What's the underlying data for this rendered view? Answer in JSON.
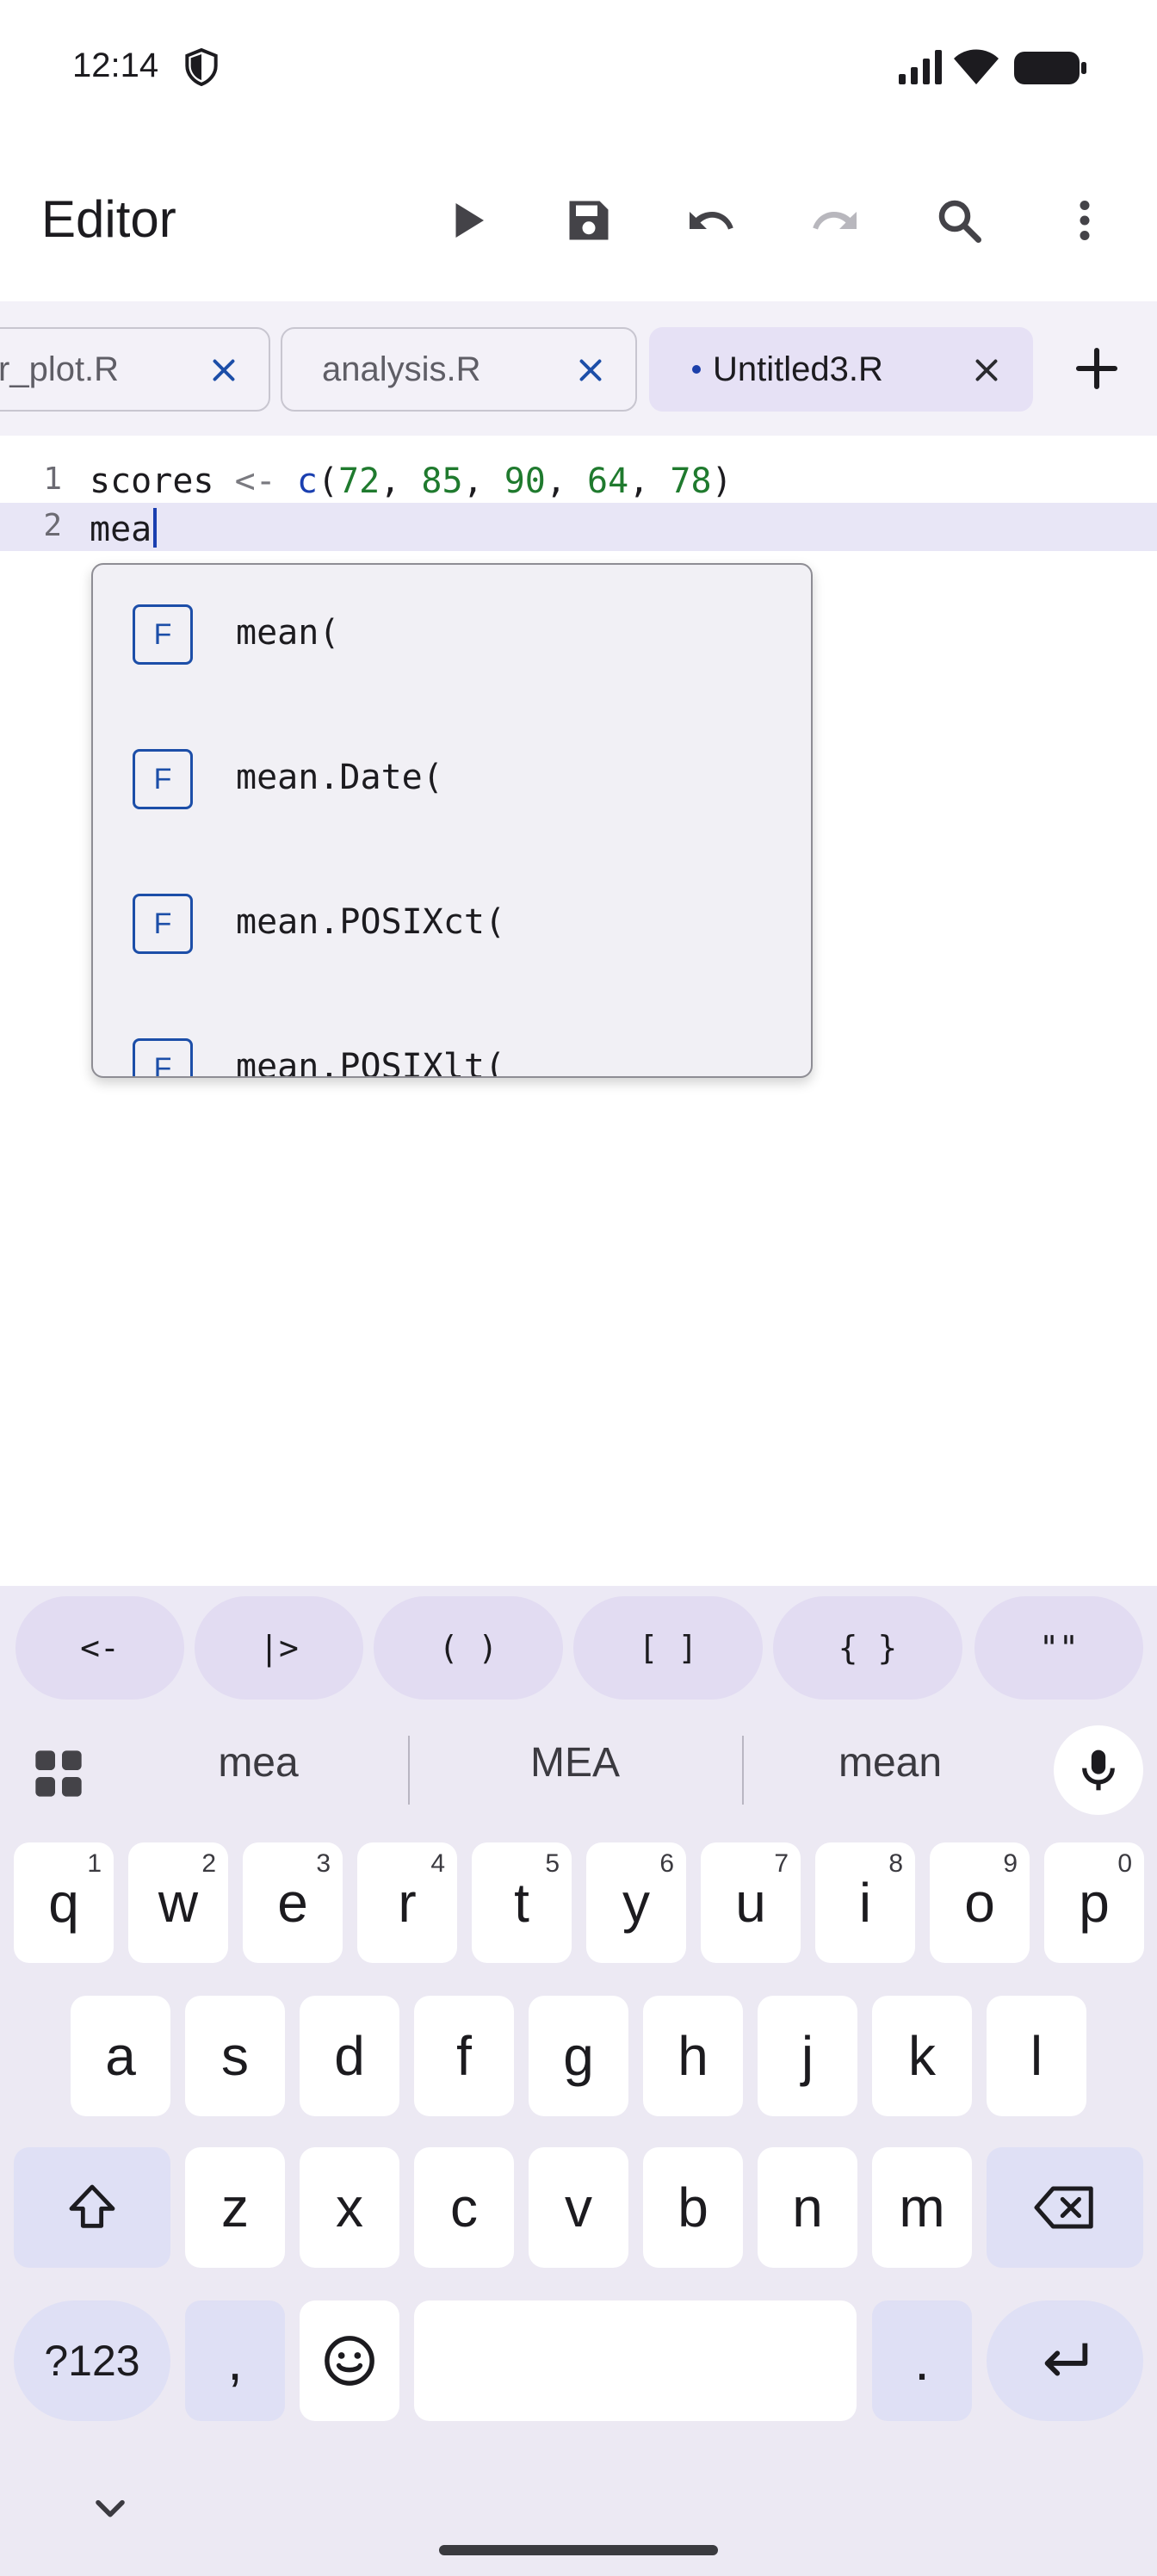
{
  "status_bar": {
    "time": "12:14"
  },
  "toolbar": {
    "title": "Editor",
    "actions": [
      "run",
      "save",
      "undo",
      "redo",
      "search",
      "more"
    ]
  },
  "tabs": [
    {
      "label": "r_plot.R",
      "active": false
    },
    {
      "label": "analysis.R",
      "active": false
    },
    {
      "label": "Untitled3.R",
      "active": true,
      "modified": true
    }
  ],
  "editor": {
    "lines": [
      {
        "number": "1",
        "tokens": {
          "var": "scores",
          "op": " <- ",
          "fn": "c",
          "open": "(",
          "n1": "72",
          "s1": ", ",
          "n2": "85",
          "s2": ", ",
          "n3": "90",
          "s3": ", ",
          "n4": "64",
          "s4": ", ",
          "n5": "78",
          "close": ")"
        }
      },
      {
        "number": "2",
        "text": "mea"
      }
    ]
  },
  "autocomplete": {
    "items": [
      {
        "kind": "F",
        "label": "mean("
      },
      {
        "kind": "F",
        "label": "mean.Date("
      },
      {
        "kind": "F",
        "label": "mean.POSIXct("
      },
      {
        "kind": "F",
        "label": "mean.POSIXlt("
      }
    ]
  },
  "symbol_bar": {
    "items": [
      "<-",
      "|>",
      "( )",
      "[ ]",
      "{ }",
      "\"\""
    ]
  },
  "keyboard": {
    "suggestions": [
      "mea",
      "MEA",
      "mean"
    ],
    "row1": [
      {
        "key": "q",
        "hint": "1"
      },
      {
        "key": "w",
        "hint": "2"
      },
      {
        "key": "e",
        "hint": "3"
      },
      {
        "key": "r",
        "hint": "4"
      },
      {
        "key": "t",
        "hint": "5"
      },
      {
        "key": "y",
        "hint": "6"
      },
      {
        "key": "u",
        "hint": "7"
      },
      {
        "key": "i",
        "hint": "8"
      },
      {
        "key": "o",
        "hint": "9"
      },
      {
        "key": "p",
        "hint": "0"
      }
    ],
    "row2": [
      "a",
      "s",
      "d",
      "f",
      "g",
      "h",
      "j",
      "k",
      "l"
    ],
    "row3": [
      "z",
      "x",
      "c",
      "v",
      "b",
      "n",
      "m"
    ],
    "symbols_key": "?123",
    "comma_key": ",",
    "period_key": "."
  },
  "colors": {
    "accent": "#1a3fb0",
    "number": "#1f7a2e",
    "current_line": "#e8e6f6",
    "active_tab": "#e6e1f5"
  }
}
